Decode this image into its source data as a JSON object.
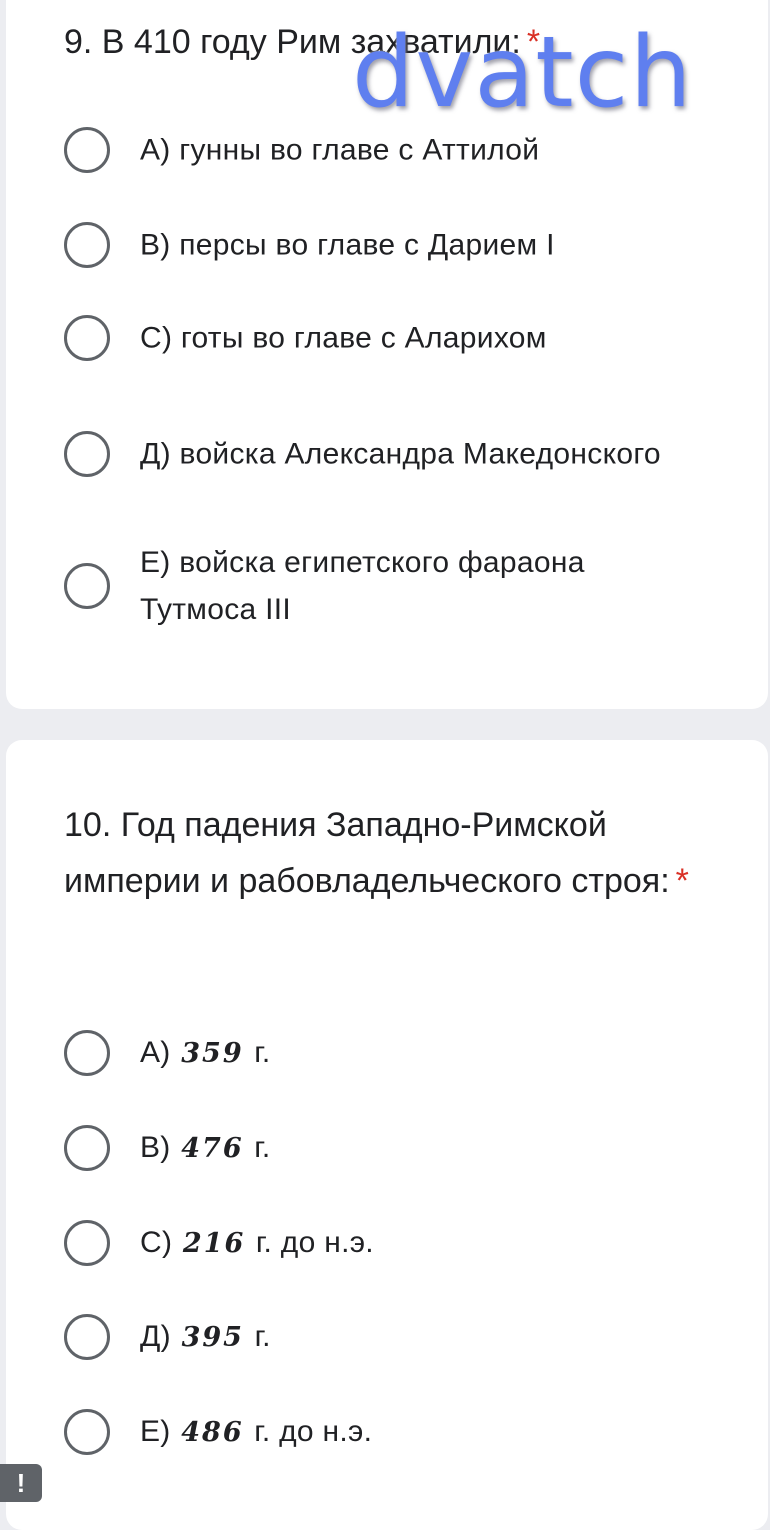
{
  "q9": {
    "title": "9. В 410 году Рим захватили:",
    "required_mark": "*",
    "options": [
      {
        "text": "А) гунны во главе с Аттилой"
      },
      {
        "text": "В) персы во главе с Дарием I"
      },
      {
        "text": "С) готы во главе с Аларихом"
      },
      {
        "text": "Д) войска Александра Македонского"
      },
      {
        "text": "Е) войска египетского фараона Тутмоса III"
      }
    ]
  },
  "q10": {
    "title": "10. Год падения Западно-Римской империи и рабовладельческого строя:",
    "required_mark": "*",
    "options": [
      {
        "letter": "А)",
        "year": "359",
        "suffix": "г."
      },
      {
        "letter": "В)",
        "year": "476",
        "suffix": "г."
      },
      {
        "letter": "С)",
        "year": "216",
        "suffix": "г. до н.э."
      },
      {
        "letter": "Д)",
        "year": "395",
        "suffix": "г."
      },
      {
        "letter": "Е)",
        "year": "486",
        "suffix": "г. до н.э."
      }
    ]
  },
  "watermark": "dvatch",
  "alert_icon_glyph": "!",
  "colors": {
    "background": "#ecedf1",
    "card": "#ffffff",
    "required": "#d93025",
    "radio_border": "#5f6368",
    "watermark": "#5f7fef"
  }
}
